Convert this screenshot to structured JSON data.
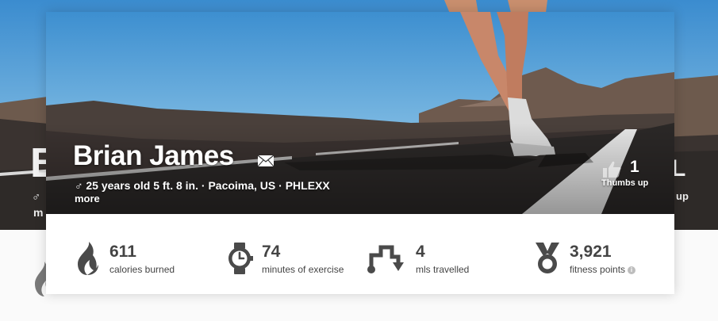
{
  "profile": {
    "name": "Brian James",
    "meta": "♂ 25 years old 5 ft. 8 in. · Pacoima, US · PHLEXX",
    "more_label": "more",
    "thumbs_count": "1",
    "thumbs_label": "Thumbs up"
  },
  "stats": [
    {
      "value": "611",
      "label": "calories burned",
      "icon": "flame-icon"
    },
    {
      "value": "74",
      "label": "minutes of exercise",
      "icon": "watch-icon"
    },
    {
      "value": "4",
      "label": "mls travelled",
      "icon": "route-arrow-icon"
    },
    {
      "value": "3,921",
      "label": "fitness points",
      "icon": "medal-icon"
    }
  ],
  "background": {
    "left_letter": "B",
    "left_line": "♂",
    "left_more": "m",
    "right_letter": "L",
    "right_label": "up"
  },
  "colors": {
    "sky_top": "#3d8fd0",
    "sky_bottom": "#a8d6ee",
    "ground": "#2f2b29",
    "stat_text": "#444444",
    "icon": "#4a4a4a"
  }
}
